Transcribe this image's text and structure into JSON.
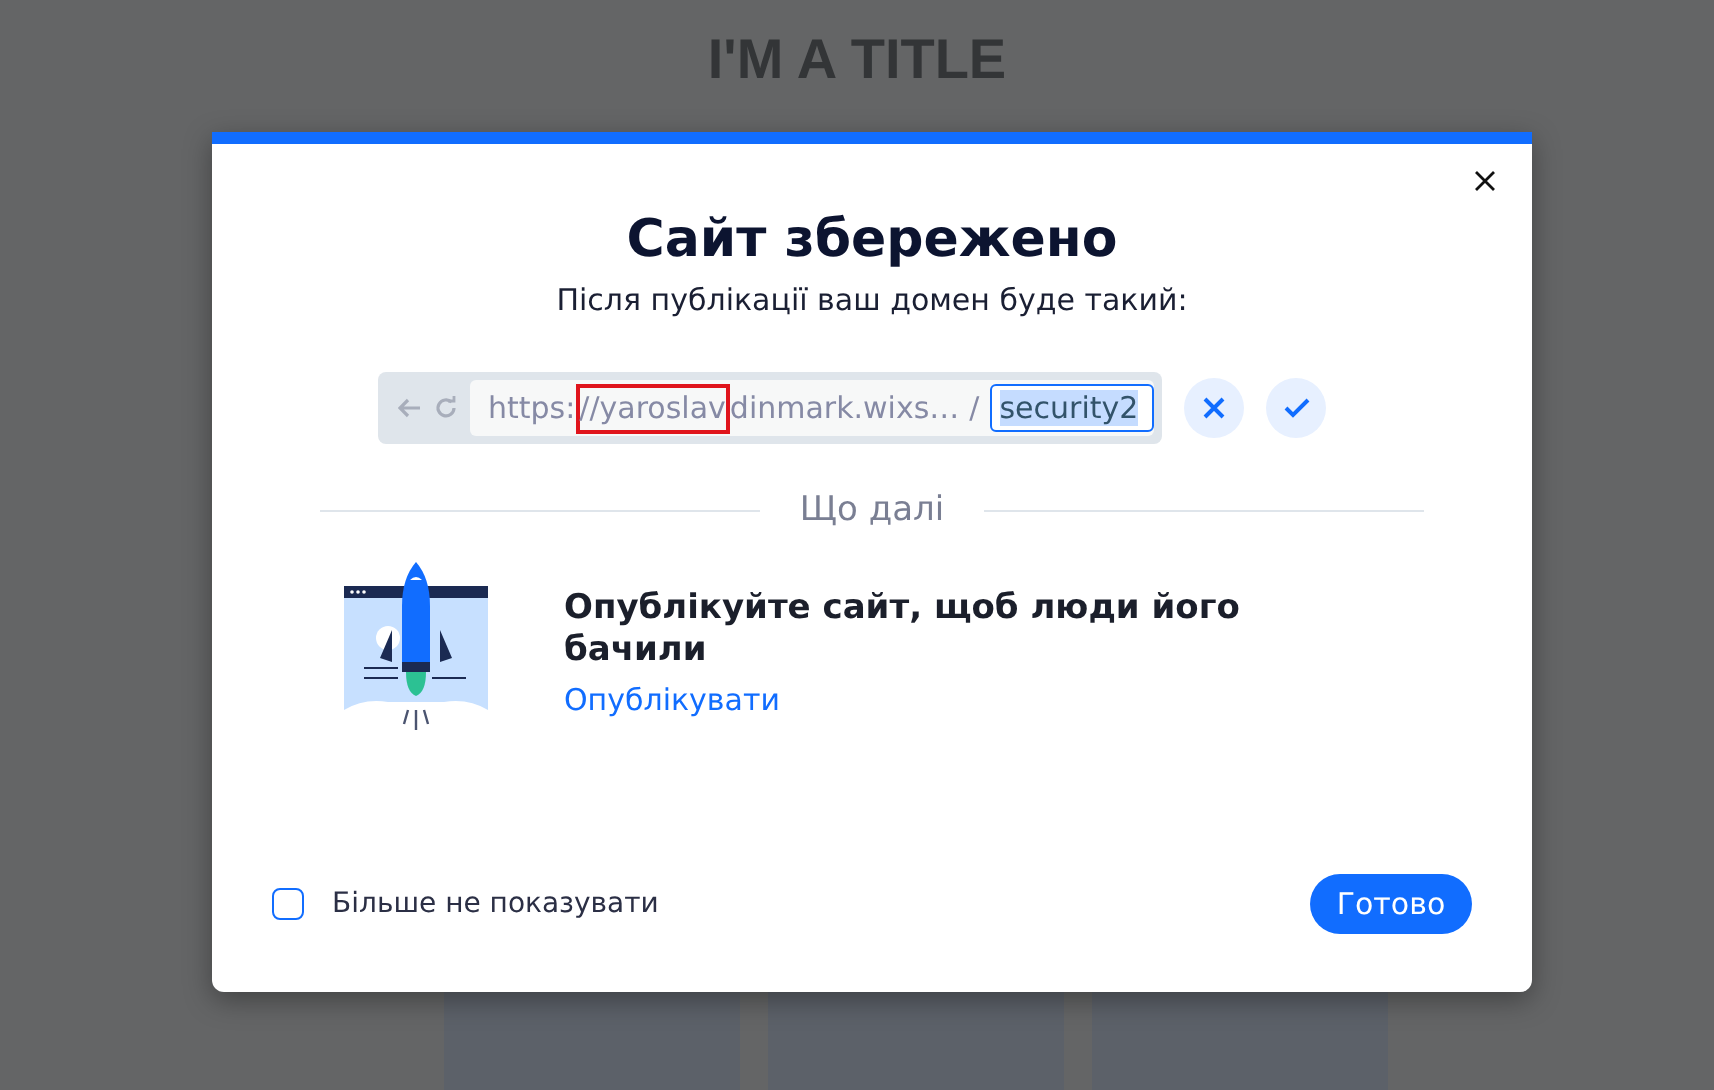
{
  "page": {
    "title": "I'M A TITLE"
  },
  "dialog": {
    "title": "Сайт збережено",
    "subtitle": "Після публікації ваш домен буде такий:",
    "url": {
      "base": [
        {
          "text": "https:",
          "highlighted": false
        },
        {
          "text": "//yaroslav",
          "highlighted": true
        },
        {
          "text": "dinmark.wixs…",
          "highlighted": false
        }
      ],
      "separator": "/",
      "slug": "security2",
      "slug_selected": true
    },
    "divider_label": "Що далі",
    "next_step": {
      "title": "Опублікуйте сайт, щоб люди його бачили",
      "link": "Опублікувати"
    },
    "checkbox": {
      "label": "Більше не показувати",
      "checked": false
    },
    "primary_button": "Готово"
  }
}
